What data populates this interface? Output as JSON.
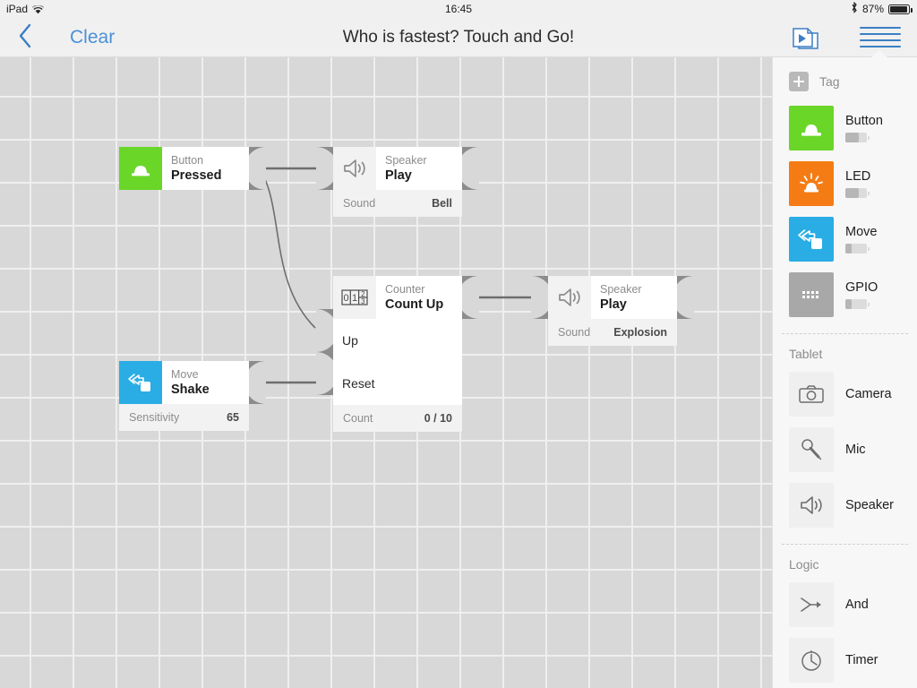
{
  "status_bar": {
    "device": "iPad",
    "wifi_icon": "wifi-icon",
    "time": "16:45",
    "bluetooth_icon": "bluetooth-icon",
    "battery_percent": "87%"
  },
  "nav_bar": {
    "back_icon": "chevron-left-icon",
    "clear_label": "Clear",
    "title": "Who is fastest? Touch and Go!",
    "play_icon": "play-stack-icon",
    "menu_icon": "hamburger-menu-icon"
  },
  "canvas": {
    "blocks": [
      {
        "id": "button-pressed",
        "kind": "Button",
        "action": "Pressed",
        "icon": "button-dome-icon",
        "icon_color": "#69d628",
        "footer_label": "",
        "footer_value": ""
      },
      {
        "id": "speaker-play-bell",
        "kind": "Speaker",
        "action": "Play",
        "icon": "speaker-icon",
        "footer_label": "Sound",
        "footer_value": "Bell"
      },
      {
        "id": "counter-count-up",
        "kind": "Counter",
        "action": "Count Up",
        "icon": "counter-digits-icon",
        "port_up": "Up",
        "port_reset": "Reset",
        "footer_label": "Count",
        "footer_value": "0 / 10"
      },
      {
        "id": "move-shake",
        "kind": "Move",
        "action": "Shake",
        "icon": "move-icon",
        "icon_color": "#29ade4",
        "footer_label": "Sensitivity",
        "footer_value": "65"
      },
      {
        "id": "speaker-play-explosion",
        "kind": "Speaker",
        "action": "Play",
        "icon": "speaker-icon",
        "footer_label": "Sound",
        "footer_value": "Explosion"
      }
    ]
  },
  "sidebar": {
    "add_button_icon": "plus-icon",
    "tag_section_label": "Tag",
    "tag_items": [
      {
        "label": "Button",
        "icon": "button-dome-icon",
        "color": "#69d628",
        "battery": 62
      },
      {
        "label": "LED",
        "icon": "led-icon",
        "color": "#f57c14",
        "battery": 62
      },
      {
        "label": "Move",
        "icon": "move-icon",
        "color": "#29ade4",
        "battery": 30
      },
      {
        "label": "GPIO",
        "icon": "gpio-icon",
        "color": "#a8a8a8",
        "battery": 30
      }
    ],
    "tablet_section_label": "Tablet",
    "tablet_items": [
      {
        "label": "Camera",
        "icon": "camera-icon"
      },
      {
        "label": "Mic",
        "icon": "mic-icon"
      },
      {
        "label": "Speaker",
        "icon": "speaker-icon"
      }
    ],
    "logic_section_label": "Logic",
    "logic_items": [
      {
        "label": "And",
        "icon": "and-gate-icon"
      },
      {
        "label": "Timer",
        "icon": "timer-icon"
      }
    ]
  }
}
